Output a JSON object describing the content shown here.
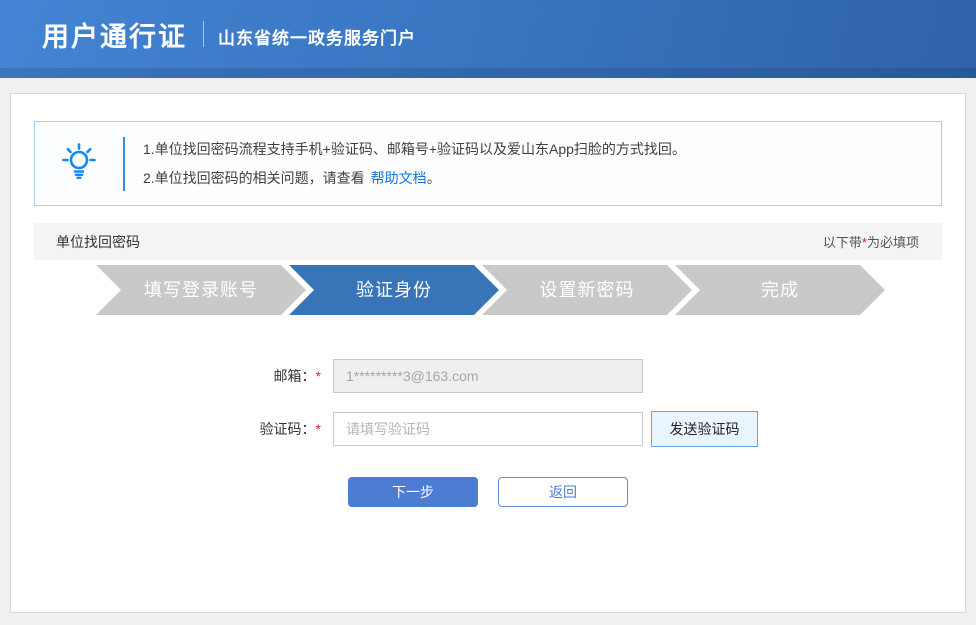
{
  "header": {
    "title": "用户通行证",
    "subtitle": "山东省统一政务服务门户"
  },
  "tips": {
    "line1": "1.单位找回密码流程支持手机+验证码、邮箱号+验证码以及爱山东App扫脸的方式找回。",
    "line2_prefix": "2.单位找回密码的相关问题，请查看",
    "line2_link": "帮助文档",
    "line2_suffix": "。"
  },
  "section": {
    "title": "单位找回密码",
    "required_prefix": "以下带",
    "required_star": "*",
    "required_suffix": "为必填项"
  },
  "steps": [
    {
      "label": "填写登录账号",
      "state": "inactive"
    },
    {
      "label": "验证身份",
      "state": "active"
    },
    {
      "label": "设置新密码",
      "state": "inactive"
    },
    {
      "label": "完成",
      "state": "inactive"
    }
  ],
  "form": {
    "email": {
      "label": "邮箱：",
      "required": "*",
      "value": "1*********3@163.com"
    },
    "code": {
      "label": "验证码：",
      "required": "*",
      "placeholder": "请填写验证码",
      "send_button": "发送验证码"
    },
    "next_button": "下一步",
    "back_button": "返回"
  },
  "colors": {
    "header_gradient_start": "#4384d4",
    "header_gradient_end": "#2f62a8",
    "step_active": "#3874b6",
    "step_inactive": "#c9c9ca",
    "primary_button": "#4d7dd2",
    "tip_border": "#a9cdec",
    "bulb_icon": "#1488f0",
    "link": "#1574d4",
    "required_star": "#e02020"
  },
  "icons": {
    "bulb": "lightbulb-icon"
  }
}
